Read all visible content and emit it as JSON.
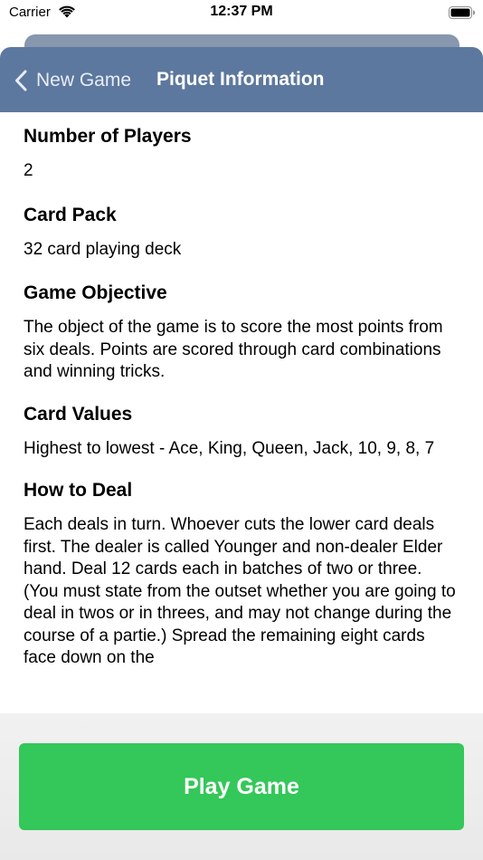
{
  "status_bar": {
    "carrier": "Carrier",
    "time": "12:37 PM"
  },
  "nav": {
    "back_label": "New Game",
    "title": "Piquet Information"
  },
  "sections": [
    {
      "heading": "Number of Players",
      "body": "2"
    },
    {
      "heading": "Card Pack",
      "body": "32 card playing deck"
    },
    {
      "heading": "Game Objective",
      "body": "The object of the game is to score the most points from six deals. Points are scored through card combinations and winning tricks."
    },
    {
      "heading": "Card Values",
      "body": "Highest to lowest - Ace, King, Queen, Jack, 10, 9, 8, 7"
    },
    {
      "heading": "How to Deal",
      "body": "Each deals in turn. Whoever cuts the lower card deals first. The dealer is called Younger and non-dealer Elder hand. Deal 12 cards each in batches of two or three. (You must state from the outset whether you are going to deal in twos or in threes, and may not change during the course of a partie.) Spread the remaining eight cards face down on the"
    }
  ],
  "actions": {
    "play_label": "Play Game"
  },
  "colors": {
    "nav_background": "#5d789e",
    "play_button": "#34c759"
  },
  "icons": [
    "wifi-icon",
    "battery-icon",
    "chevron-left-icon"
  ]
}
